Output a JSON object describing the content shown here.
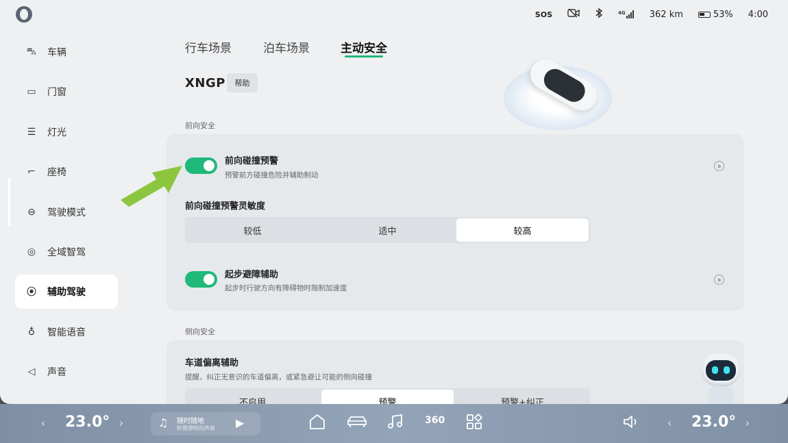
{
  "status_bar": {
    "sos": "SOS",
    "network": "4G",
    "range": "362 km",
    "battery": "53%",
    "battery_level": 0.53,
    "time": "4:00"
  },
  "sidebar": {
    "items": [
      {
        "label": "车辆",
        "icon": "car-icon"
      },
      {
        "label": "门窗",
        "icon": "door-icon"
      },
      {
        "label": "灯光",
        "icon": "headlight-icon"
      },
      {
        "label": "座椅",
        "icon": "seat-icon"
      },
      {
        "label": "驾驶模式",
        "icon": "steering-wheel-icon"
      },
      {
        "label": "全域智驾",
        "icon": "smart-drive-icon"
      },
      {
        "label": "辅助驾驶",
        "icon": "assist-drive-icon"
      },
      {
        "label": "智能语音",
        "icon": "microphone-icon"
      },
      {
        "label": "声音",
        "icon": "speaker-icon"
      }
    ],
    "active_index": 6
  },
  "tabs": [
    {
      "label": "行车场景"
    },
    {
      "label": "泊车场景"
    },
    {
      "label": "主动安全"
    }
  ],
  "active_tab": 2,
  "header": {
    "title": "XNGP",
    "help_label": "帮助"
  },
  "sections": {
    "front": {
      "label": "前向安全",
      "fcw": {
        "title": "前向碰撞预警",
        "desc": "预警前方碰撞危险并辅助制动",
        "enabled": true
      },
      "sensitivity": {
        "title": "前向碰撞预警灵敏度",
        "options": [
          "较低",
          "适中",
          "较高"
        ],
        "selected": 2
      },
      "start_assist": {
        "title": "起步避障辅助",
        "desc": "起步时行驶方向有障碍物时限制加速度",
        "enabled": true
      }
    },
    "side": {
      "label": "侧向安全",
      "lane": {
        "title": "车道偏离辅助",
        "desc": "提醒、纠正无意识的车道偏离，或紧急避让可能的侧向碰撞",
        "options": [
          "不启用",
          "预警",
          "预警+纠正"
        ],
        "selected": 1
      }
    }
  },
  "dock": {
    "left_temp": "23.0°",
    "right_temp": "23.0°",
    "music_title": "随时随地",
    "music_sub": "听我想听的声音",
    "view_360": "360"
  },
  "colors": {
    "accent": "#1fb97a",
    "arrow": "#8cc63f"
  }
}
